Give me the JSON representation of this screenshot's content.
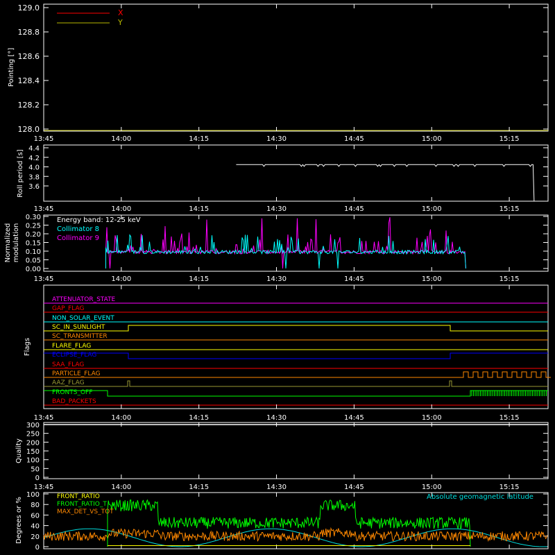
{
  "colors": {
    "frame": "#ffffff",
    "x": "#ff0000",
    "y": "#b7b700",
    "roll": "#ffffff",
    "c8": "#00ffff",
    "c9": "#ff00ff",
    "quality": "#ffffff",
    "front_ratio": "#ffff00",
    "front_ratio_t": "#00ff00",
    "max_det": "#ff8800",
    "geomag": "#00dddd"
  },
  "time_axis": {
    "range_hours": [
      13.75,
      15.375
    ],
    "tick_labels": [
      "13:45",
      "14:00",
      "14:15",
      "14:30",
      "14:45",
      "15:00",
      "15:15"
    ],
    "tick_hours": [
      13.75,
      14.0,
      14.25,
      14.5,
      14.75,
      15.0,
      15.25
    ]
  },
  "chart_data": [
    {
      "type": "line",
      "ylabel": "Pointing [°]",
      "ylim": [
        128.0,
        129.0
      ],
      "ytick_labels": [
        "128.0",
        "128.2",
        "128.4",
        "128.6",
        "128.8",
        "129.0"
      ],
      "legend": [
        "X",
        "Y"
      ],
      "legend_position": "top-left",
      "series": [
        {
          "name": "X",
          "values": []
        },
        {
          "name": "Y",
          "values": []
        }
      ]
    },
    {
      "type": "line",
      "ylabel": "Roll period [s]",
      "ylim": [
        3.5,
        4.5
      ],
      "ytick_labels": [
        "3.6",
        "3.8",
        "4.0",
        "4.2",
        "4.4"
      ],
      "series": [
        {
          "name": "Roll period",
          "x": [
            14.37,
            15.33,
            15.33
          ],
          "values": [
            4.15,
            4.15,
            3.5
          ]
        }
      ]
    },
    {
      "type": "line",
      "ylabel": "Normalized modulation",
      "ylim": [
        0,
        0.3
      ],
      "ytick_labels": [
        "0.00",
        "0.05",
        "0.10",
        "0.15",
        "0.20",
        "0.25",
        "0.30"
      ],
      "annotation": "Energy band: 12-25 keV",
      "legend": [
        "Collimator 8",
        "Collimator 9"
      ],
      "series": [
        {
          "name": "Collimator 8",
          "x_start": 13.95,
          "x_end": 15.11,
          "baseline": 0.095
        },
        {
          "name": "Collimator 9",
          "x_start": 13.95,
          "x_end": 15.11,
          "baseline": 0.095
        }
      ]
    },
    {
      "type": "line",
      "ylabel": "Flags",
      "flags": [
        {
          "label": "ATTENUATOR_STATE",
          "color": "#ff00ff"
        },
        {
          "label": "GAP_FLAG",
          "color": "#ff0000"
        },
        {
          "label": "NON_SOLAR_EVENT",
          "color": "#00ffff"
        },
        {
          "label": "SC_IN_SUNLIGHT",
          "color": "#ffff00"
        },
        {
          "label": "SC_TRANSMITTER",
          "color": "#ff8800"
        },
        {
          "label": "FLARE_FLAG",
          "color": "#ffff00"
        },
        {
          "label": "ECLIPSE_FLAG",
          "color": "#0000ff"
        },
        {
          "label": "SAA_FLAG",
          "color": "#ff0000"
        },
        {
          "label": "PARTICLE_FLAG",
          "color": "#ff8800"
        },
        {
          "label": "AAZ_FLAG",
          "color": "#999933"
        },
        {
          "label": "FRONTS_OFF",
          "color": "#00ff00"
        },
        {
          "label": "BAD_PACKETS",
          "color": "#ff0000"
        }
      ]
    },
    {
      "type": "line",
      "ylabel": "Quality",
      "ylim": [
        0,
        300
      ],
      "ytick_labels": [
        "0",
        "50",
        "100",
        "150",
        "200",
        "250",
        "300"
      ],
      "series": [
        {
          "name": "Quality",
          "x": [
            13.75,
            15.375
          ],
          "values": [
            300,
            300
          ]
        }
      ]
    },
    {
      "type": "line",
      "ylabel": "Degrees or %",
      "ylim": [
        0,
        100
      ],
      "ytick_labels": [
        "0",
        "20",
        "40",
        "60",
        "80",
        "100"
      ],
      "legend": [
        "FRONT_RATIO",
        "FRONT_RATIO_T",
        "MAX_DET_VS_TOT"
      ],
      "annotation": "Absolute geomagnetic latitude",
      "series": [
        {
          "name": "FRONT_RATIO",
          "note": "near zero"
        },
        {
          "name": "FRONT_RATIO_T",
          "baseline": 45
        },
        {
          "name": "MAX_DET_VS_TOT",
          "baseline": 20
        },
        {
          "name": "Absolute geomagnetic latitude",
          "range": [
            0,
            35
          ]
        }
      ]
    }
  ]
}
